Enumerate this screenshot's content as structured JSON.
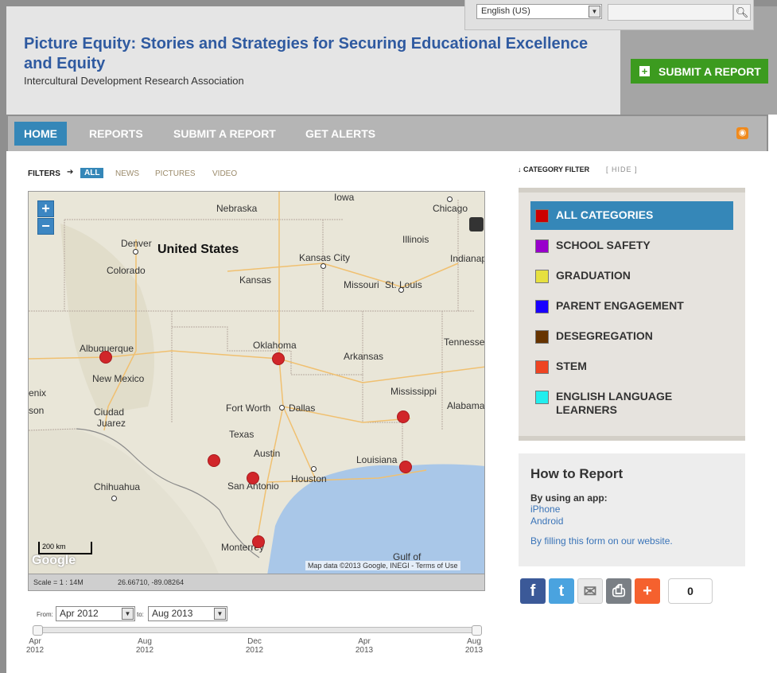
{
  "header": {
    "title": "Picture Equity: Stories and Strategies for Securing Educational Excellence and Equity",
    "subtitle": "Intercultural Development Research Association",
    "language": "English (US)",
    "search_placeholder": "",
    "submit_label": "SUBMIT A REPORT"
  },
  "nav": {
    "items": [
      {
        "label": "HOME",
        "active": true
      },
      {
        "label": "REPORTS"
      },
      {
        "label": "SUBMIT A REPORT"
      },
      {
        "label": "GET ALERTS"
      }
    ]
  },
  "filters": {
    "label": "FILTERS",
    "items": [
      "ALL",
      "NEWS",
      "PICTURES",
      "VIDEO"
    ],
    "active": "ALL"
  },
  "map": {
    "labels": [
      "Iowa",
      "Chicago",
      "Nebraska",
      "Illinois",
      "Indianap",
      "Denver",
      "United States",
      "Kansas City",
      "Colorado",
      "Kansas",
      "Missouri",
      "St. Louis",
      "Tennessee",
      "Albuquerque",
      "Oklahoma",
      "Arkansas",
      "New Mexico",
      "Mississippi",
      "Alabama",
      "enix",
      "son",
      "Ciudad",
      "Juarez",
      "Fort Worth",
      "Dallas",
      "Texas",
      "Austin",
      "Louisiana",
      "Houston",
      "San Antonio",
      "Chihuahua",
      "Monterrey",
      "Gulf of"
    ],
    "scale_label": "200 km",
    "attribution": "Map data ©2013 Google, INEGI - Terms of Use",
    "google_logo": "Google",
    "scale_text": "Scale = 1 : 14M",
    "coordinates": "26.66710, -89.08264",
    "zoom_in": "+",
    "zoom_out": "−"
  },
  "date_range": {
    "from_label": "From:",
    "to_label": "to:",
    "from_value": "Apr 2012",
    "to_value": "Aug 2013",
    "ticks": [
      {
        "month": "Apr",
        "year": "2012"
      },
      {
        "month": "Aug",
        "year": "2012"
      },
      {
        "month": "Dec",
        "year": "2012"
      },
      {
        "month": "Apr",
        "year": "2013"
      },
      {
        "month": "Aug",
        "year": "2013"
      }
    ]
  },
  "category_filter": {
    "title": "CATEGORY FILTER",
    "hide_label": "[ HIDE ]",
    "categories": [
      {
        "label": "ALL CATEGORIES",
        "color": "#cc0000",
        "active": true
      },
      {
        "label": "SCHOOL SAFETY",
        "color": "#9900cc"
      },
      {
        "label": "GRADUATION",
        "color": "#e6e040"
      },
      {
        "label": "PARENT ENGAGEMENT",
        "color": "#1a00ff"
      },
      {
        "label": "DESEGREGATION",
        "color": "#663300"
      },
      {
        "label": "STEM",
        "color": "#ee4422"
      },
      {
        "label": "ENGLISH LANGUAGE LEARNERS",
        "color": "#22eeee"
      }
    ]
  },
  "how_to_report": {
    "title": "How to Report",
    "by_app": "By using an app:",
    "iphone": "iPhone",
    "android": "Android",
    "form_link": "By filling this form on our website."
  },
  "share": {
    "count": "0"
  },
  "colors": {
    "brand_blue": "#2f5aa0",
    "nav_active": "#3587b8",
    "submit_green": "#3c9b1f",
    "marker_red": "#d1262a"
  }
}
